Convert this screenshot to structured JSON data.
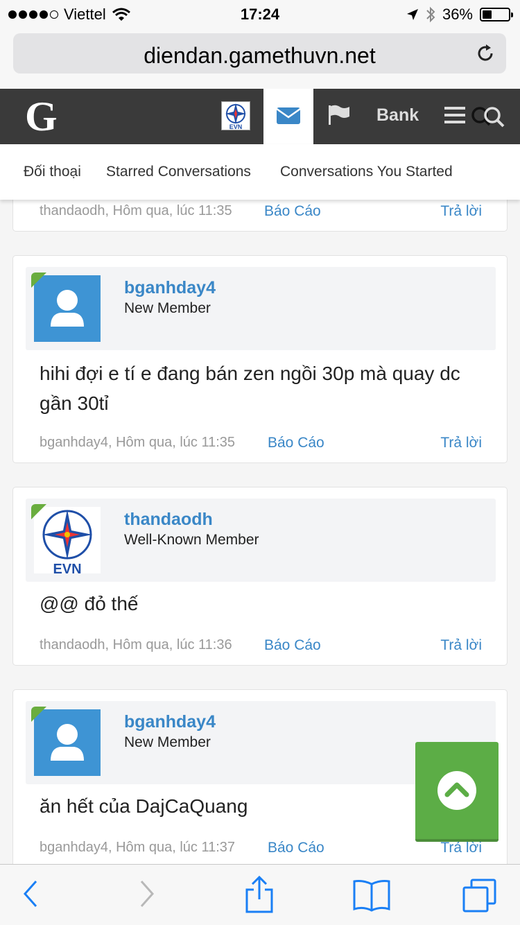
{
  "statusbar": {
    "carrier": "Viettel",
    "time": "17:24",
    "battery": "36%",
    "battery_level": 0.36
  },
  "browser": {
    "url": "diendan.gamethuvn.net"
  },
  "nav": {
    "logo": "G",
    "bank_label": "Bank"
  },
  "subnav": {
    "items": [
      "Đối thoại",
      "Starred Conversations",
      "Conversations You Started"
    ]
  },
  "posts": [
    {
      "meta": "thandaodh, Hôm qua, lúc 11:35",
      "report": "Báo Cáo",
      "reply": "Trả lời"
    },
    {
      "username": "bganhday4",
      "role": "New Member",
      "body": "hihi đợi e tí e đang bán zen ngồi 30p mà quay dc gần 30tỉ",
      "meta": "bganhday4, Hôm qua, lúc 11:35",
      "report": "Báo Cáo",
      "reply": "Trả lời"
    },
    {
      "username": "thandaodh",
      "role": "Well-Known Member",
      "body": "@@ đỏ thế",
      "meta": "thandaodh, Hôm qua, lúc 11:36",
      "report": "Báo Cáo",
      "reply": "Trả lời"
    },
    {
      "username": "bganhday4",
      "role": "New Member",
      "body": "ăn hết của DajCaQuang",
      "meta": "bganhday4, Hôm qua, lúc 11:37",
      "report": "Báo Cáo",
      "reply": "Trả lời"
    }
  ],
  "evn_label": "EVN",
  "colors": {
    "link": "#3a87c7",
    "nav_bg": "#3a3a3a",
    "avatar_blue": "#3e94d4",
    "green": "#5cad46"
  },
  "icons": [
    "wifi-icon",
    "location-arrow-icon",
    "bluetooth-icon",
    "reload-icon",
    "envelope-icon",
    "flag-icon",
    "menu-icon",
    "search-icon",
    "chevron-up-icon",
    "back-icon",
    "forward-icon",
    "share-icon",
    "bookmarks-icon",
    "tabs-icon"
  ]
}
